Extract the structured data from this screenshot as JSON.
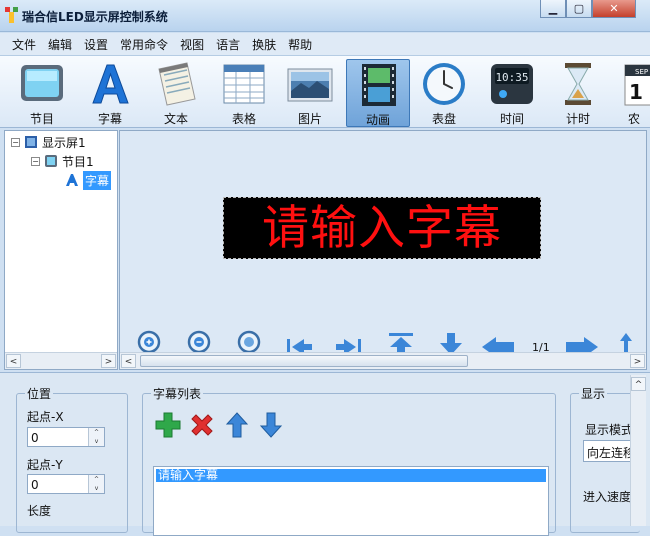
{
  "window": {
    "title": "瑞合信LED显示屏控制系统",
    "controls": {
      "minimize": "▁",
      "restore": "▢",
      "close": "✕"
    }
  },
  "menu": [
    "文件",
    "编辑",
    "设置",
    "常用命令",
    "视图",
    "语言",
    "换肤",
    "帮助"
  ],
  "toolbar": {
    "items": [
      {
        "label": "节目",
        "icon": "program-icon"
      },
      {
        "label": "字幕",
        "icon": "subtitle-icon"
      },
      {
        "label": "文本",
        "icon": "text-icon"
      },
      {
        "label": "表格",
        "icon": "table-icon"
      },
      {
        "label": "图片",
        "icon": "picture-icon"
      },
      {
        "label": "动画",
        "icon": "animation-icon",
        "active": true
      },
      {
        "label": "表盘",
        "icon": "clock-icon"
      },
      {
        "label": "时间",
        "icon": "time-icon"
      },
      {
        "label": "计时",
        "icon": "hourglass-icon"
      },
      {
        "label": "农",
        "icon": "calendar-icon"
      }
    ],
    "calendar_month": "SEP",
    "calendar_day": "1",
    "time_display": "10:35"
  },
  "tree": {
    "root": "显示屏1",
    "program": "节目1",
    "subtitle": "字幕",
    "expander_collapse": "−"
  },
  "preview": {
    "led_text": "请输入字幕",
    "led_color": "#ff1010",
    "page_indicator": "1/1"
  },
  "scroll": {
    "left": "<",
    "right": ">",
    "up": "^",
    "down": "v"
  },
  "props": {
    "position": {
      "title": "位置",
      "x_label": "起点-X",
      "x_value": "0",
      "y_label": "起点-Y",
      "y_value": "0",
      "length_label": "长度"
    },
    "subtitle_list": {
      "title": "字幕列表",
      "items": [
        "请输入字幕"
      ]
    },
    "display": {
      "title": "显示",
      "mode_label": "显示模式",
      "mode_value": "向左连移",
      "speed_label": "进入速度"
    }
  },
  "colors": {
    "accent": "#3399ff",
    "add": "#2fa84a",
    "delete": "#e03030",
    "arrow": "#3b86d8"
  }
}
